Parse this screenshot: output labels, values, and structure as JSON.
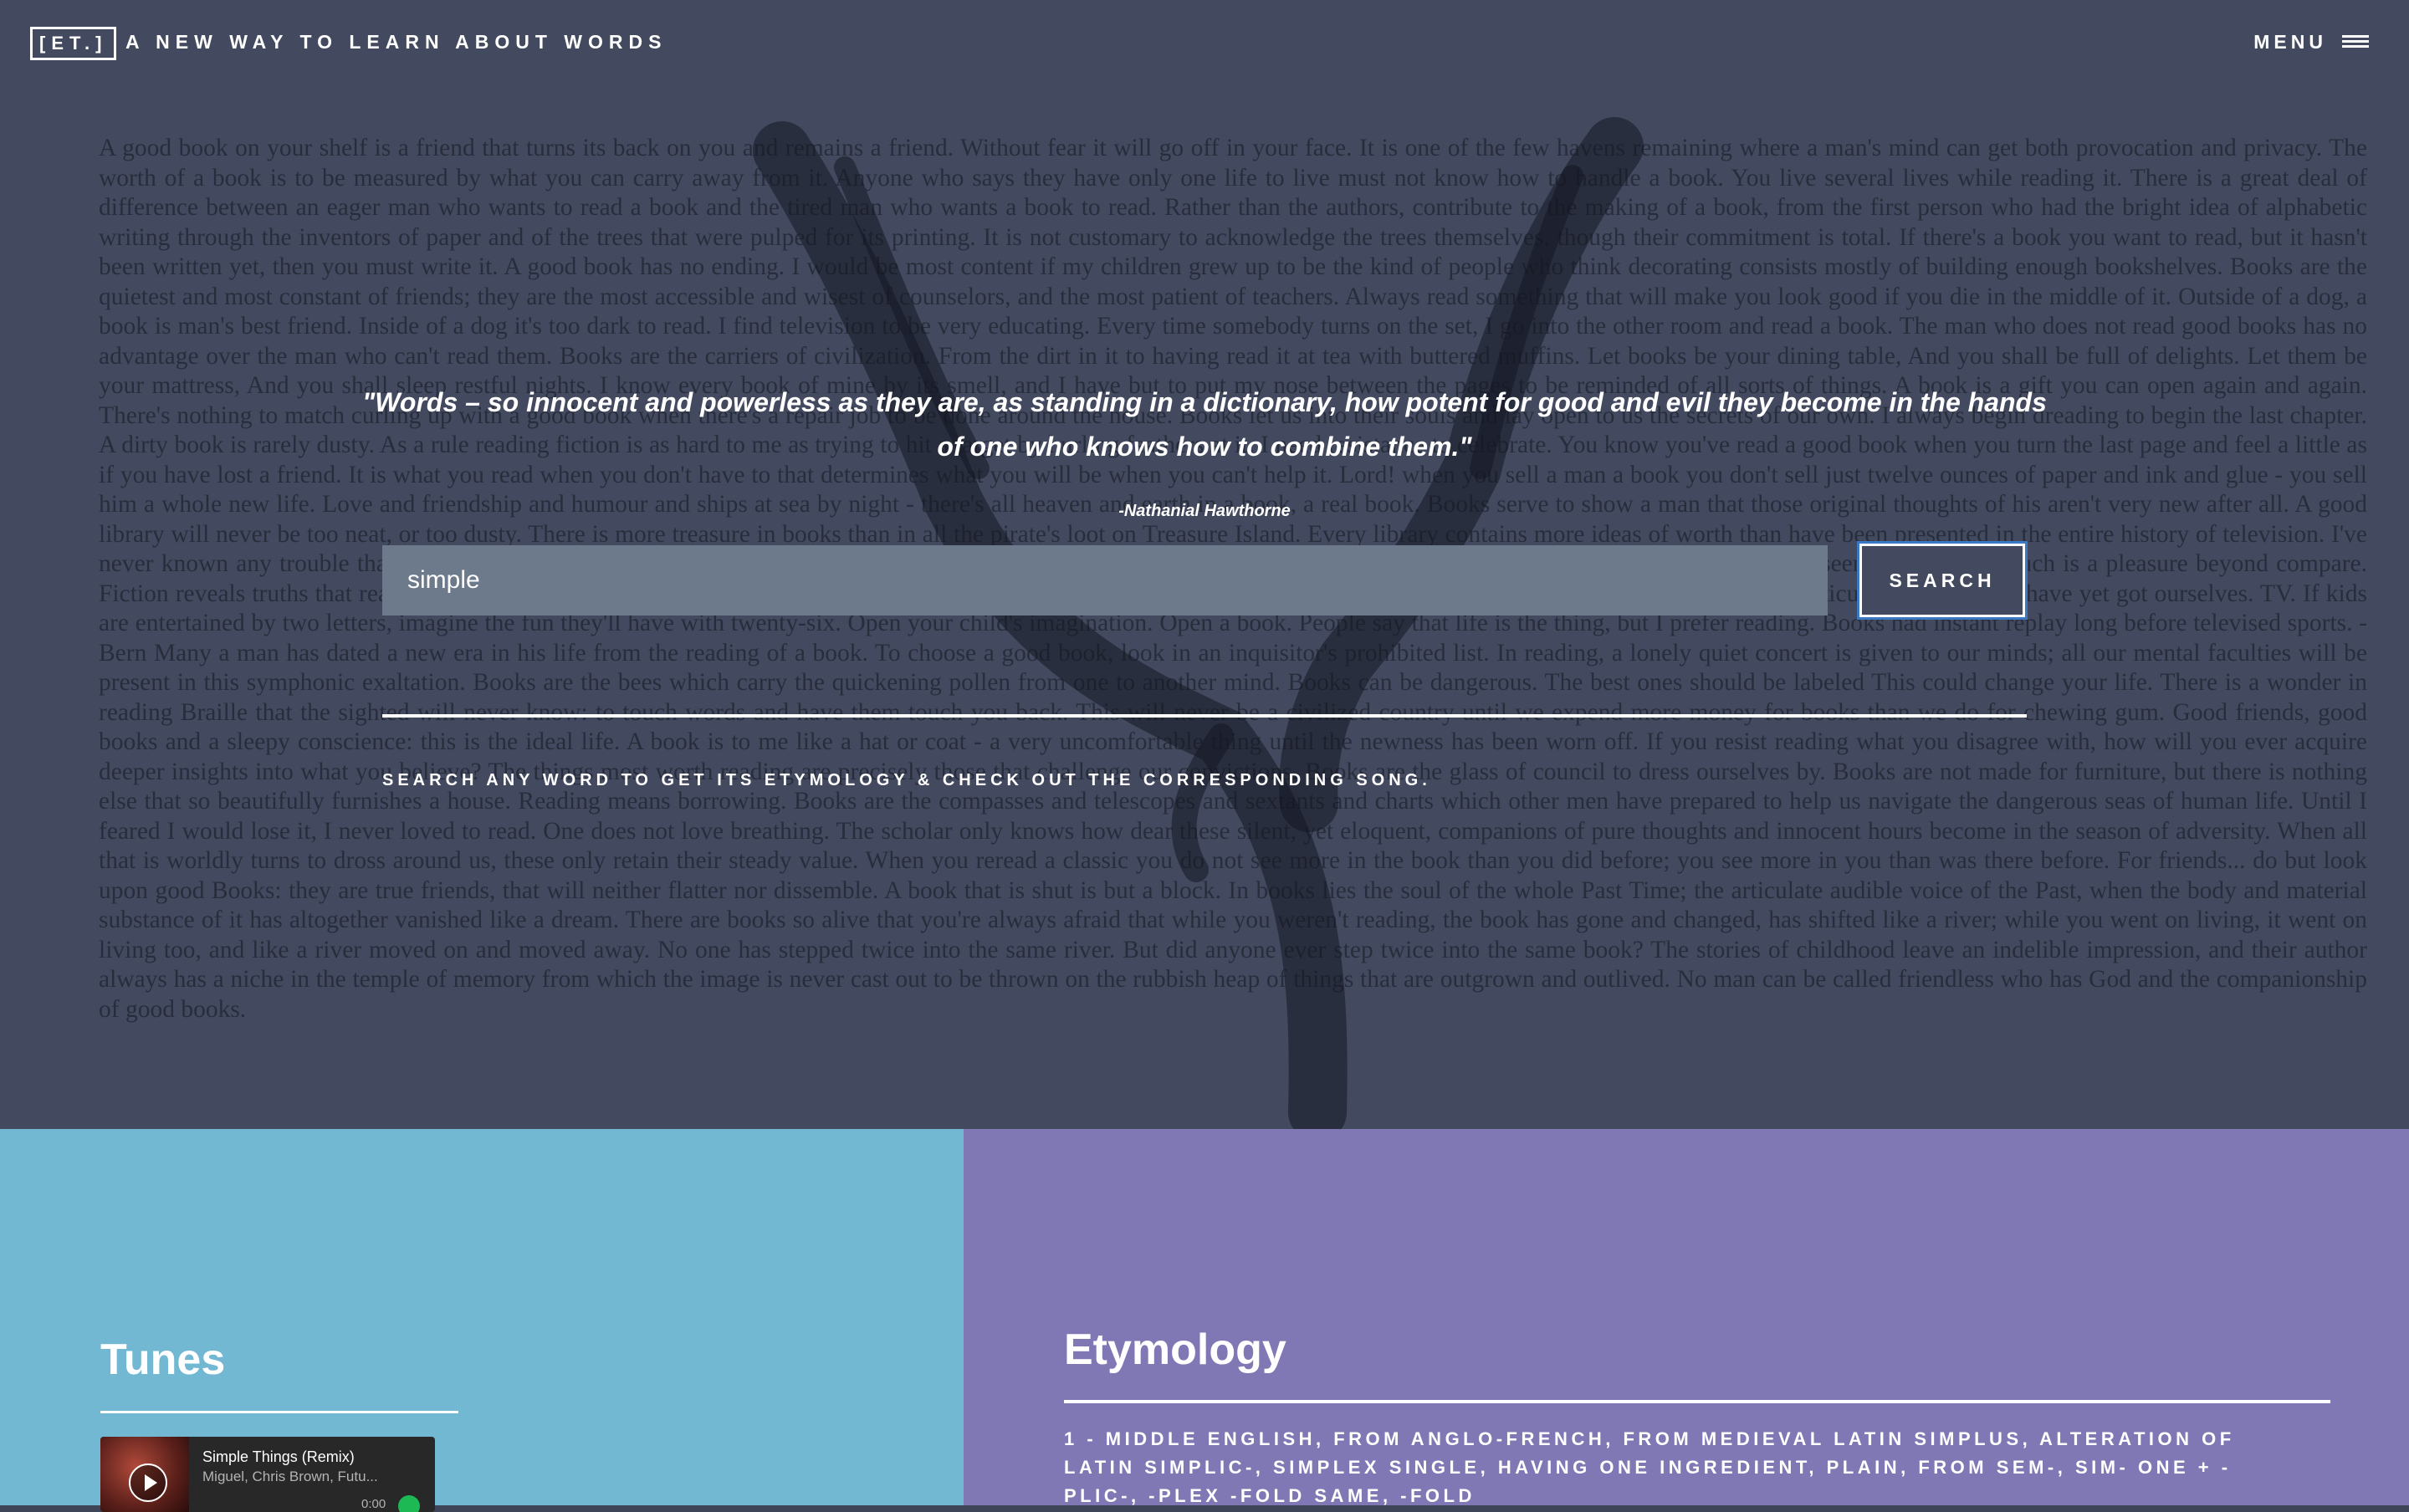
{
  "header": {
    "logo": "[ET.]",
    "tagline": "A NEW WAY TO LEARN ABOUT WORDS",
    "menu_label": "MENU"
  },
  "hero": {
    "background_text": "A good book on your shelf is a friend that turns its back on you and remains a friend. Without fear it will go off in your face. It is one of the few havens remaining where a man's mind can get both provocation and privacy. The worth of a book is to be measured by what you can carry away from it. Anyone who says they have only one life to live must not know how to handle a book. You live several lives while reading it. There is a great deal of difference between an eager man who wants to read a book and the tired man who wants a book to read. Rather than the authors, contribute to the making of a book, from the first person who had the bright idea of alphabetic writing through the inventors of paper and of the trees that were pulped for its printing. It is not customary to acknowledge the trees themselves, though their commitment is total. If there's a book you want to read, but it hasn't been written yet, then you must write it. A good book has no ending. I would be most content if my children grew up to be the kind of people who think decorating consists mostly of building enough bookshelves. Books are the quietest and most constant of friends; they are the most accessible and wisest of counselors, and the most patient of teachers. Always read something that will make you look good if you die in the middle of it. Outside of a dog, a book is man's best friend. Inside of a dog it's too dark to read. I find television to be very educating. Every time somebody turns on the set, I go into the other room and read a book. The man who does not read good books has no advantage over the man who can't read them. Books are the carriers of civilization. From the dirt in it to having read it at tea with buttered muffins. Let books be your dining table, And you shall be full of delights. Let them be your mattress, And you shall sleep restful nights. I know every book of mine by its smell, and I have but to put my nose between the pages to be reminded of all sorts of things. A book is a gift you can open again and again. There's nothing to match curling up with a good book when there's a repair job to be done around the house. Books let us into their souls and lay open to us the secrets of our own. I always begin dreading to begin the last chapter. A dirty book is rarely dusty. As a rule reading fiction is as hard to me as trying to hit a target by hurling feathers at it. I need resistance to celebrate. You know you've read a good book when you turn the last page and feel a little as if you have lost a friend. It is what you read when you don't have to that determines what you will be when you can't help it. Lord! when you sell a man a book you don't sell just twelve ounces of paper and ink and glue - you sell him a whole new life. Love and friendship and humour and ships at sea by night - there's all heaven and earth in a book, a real book. Books serve to show a man that those original thoughts of his aren't very new after all. A good library will never be too neat, or too dusty. There is more treasure in books than in all the pirate's loot on Treasure Island. Every library contains more ideas of worth than have been presented in the entire history of television. I've never known any trouble that an hour's reading didn't assuage. To sit alone in the lamplight with a book spread out before you, and hold intimate converse with men of unseen generations - such is a pleasure beyond compare. Fiction reveals truths that reality obscures. I suggest that the only books that influence us are those for which we are ready, and which have gone a little farther down our particular path than we have yet got ourselves. TV. If kids are entertained by two letters, imagine the fun they'll have with twenty-six. Open your child's imagination. Open a book. People say that life is the thing, but I prefer reading. Books had instant replay long before televised sports. -Bern Many a man has dated a new era in his life from the reading of a book. To choose a good book, look in an inquisitor's prohibited list. In reading, a lonely quiet concert is given to our minds; all our mental faculties will be present in this symphonic exaltation. Books are the bees which carry the quickening pollen from one to another mind. Books can be dangerous. The best ones should be labeled This could change your life. There is a wonder in reading Braille that the sighted will never know: to touch words and have them touch you back. This will never be a civilized country until we expend more money for books than we do for chewing gum. Good friends, good books and a sleepy conscience: this is the ideal life. A book is to me like a hat or coat - a very uncomfortable thing until the newness has been worn off. If you resist reading what you disagree with, how will you ever acquire deeper insights into what you believe? The things most worth reading are precisely those that challenge our convictions. Books are the glass of council to dress ourselves by. Books are not made for furniture, but there is nothing else that so beautifully furnishes a house. Reading means borrowing. Books are the compasses and telescopes and sextants and charts which other men have prepared to help us navigate the dangerous seas of human life. Until I feared I would lose it, I never loved to read. One does not love breathing. The scholar only knows how dear these silent, yet eloquent, companions of pure thoughts and innocent hours become in the season of adversity. When all that is worldly turns to dross around us, these only retain their steady value. When you reread a classic you do not see more in the book than you did before; you see more in you than was there before. For friends... do but look upon good Books: they are true friends, that will neither flatter nor dissemble. A book that is shut is but a block. In books lies the soul of the whole Past Time; the articulate audible voice of the Past, when the body and material substance of it has altogether vanished like a dream. There are books so alive that you're always afraid that while you weren't reading, the book has gone and changed, has shifted like a river; while you went on living, it went on living too, and like a river moved on and moved away. No one has stepped twice into the same river. But did anyone ever step twice into the same book? The stories of childhood leave an indelible impression, and their author always has a niche in the temple of memory from which the image is never cast out to be thrown on the rubbish heap of things that are outgrown and outlived. No man can be called friendless who has God and the companionship of good books.",
    "quote": "\"Words – so innocent and powerless as they are, as standing in a dictionary, how potent for good and evil they become in the hands of one who knows how to combine them.\"",
    "author": "-Nathanial Hawthorne"
  },
  "search": {
    "value": "simple",
    "button_label": "SEARCH",
    "instructions": "SEARCH ANY WORD TO GET ITS ETYMOLOGY & CHECK OUT THE CORRESPONDING SONG."
  },
  "tunes": {
    "title": "Tunes",
    "track_title": "Simple Things (Remix)",
    "track_artist": "Miguel, Chris Brown, Futu...",
    "time": "0:00"
  },
  "etymology": {
    "title": "Etymology",
    "text": "1 - MIDDLE ENGLISH, FROM ANGLO-FRENCH, FROM MEDIEVAL LATIN SIMPLUS, ALTERATION OF LATIN SIMPLIC-, SIMPLEX SINGLE, HAVING ONE INGREDIENT, PLAIN, FROM SEM-, SIM- ONE + -PLIC-, -PLEX -FOLD SAME, -FOLD"
  },
  "colors": {
    "hero_bg": "#434a5f",
    "tunes_bg": "#72b8d2",
    "etymology_bg": "#8078b4",
    "search_input_bg": "#6d7a8b",
    "focus_ring": "#3a78c4"
  }
}
